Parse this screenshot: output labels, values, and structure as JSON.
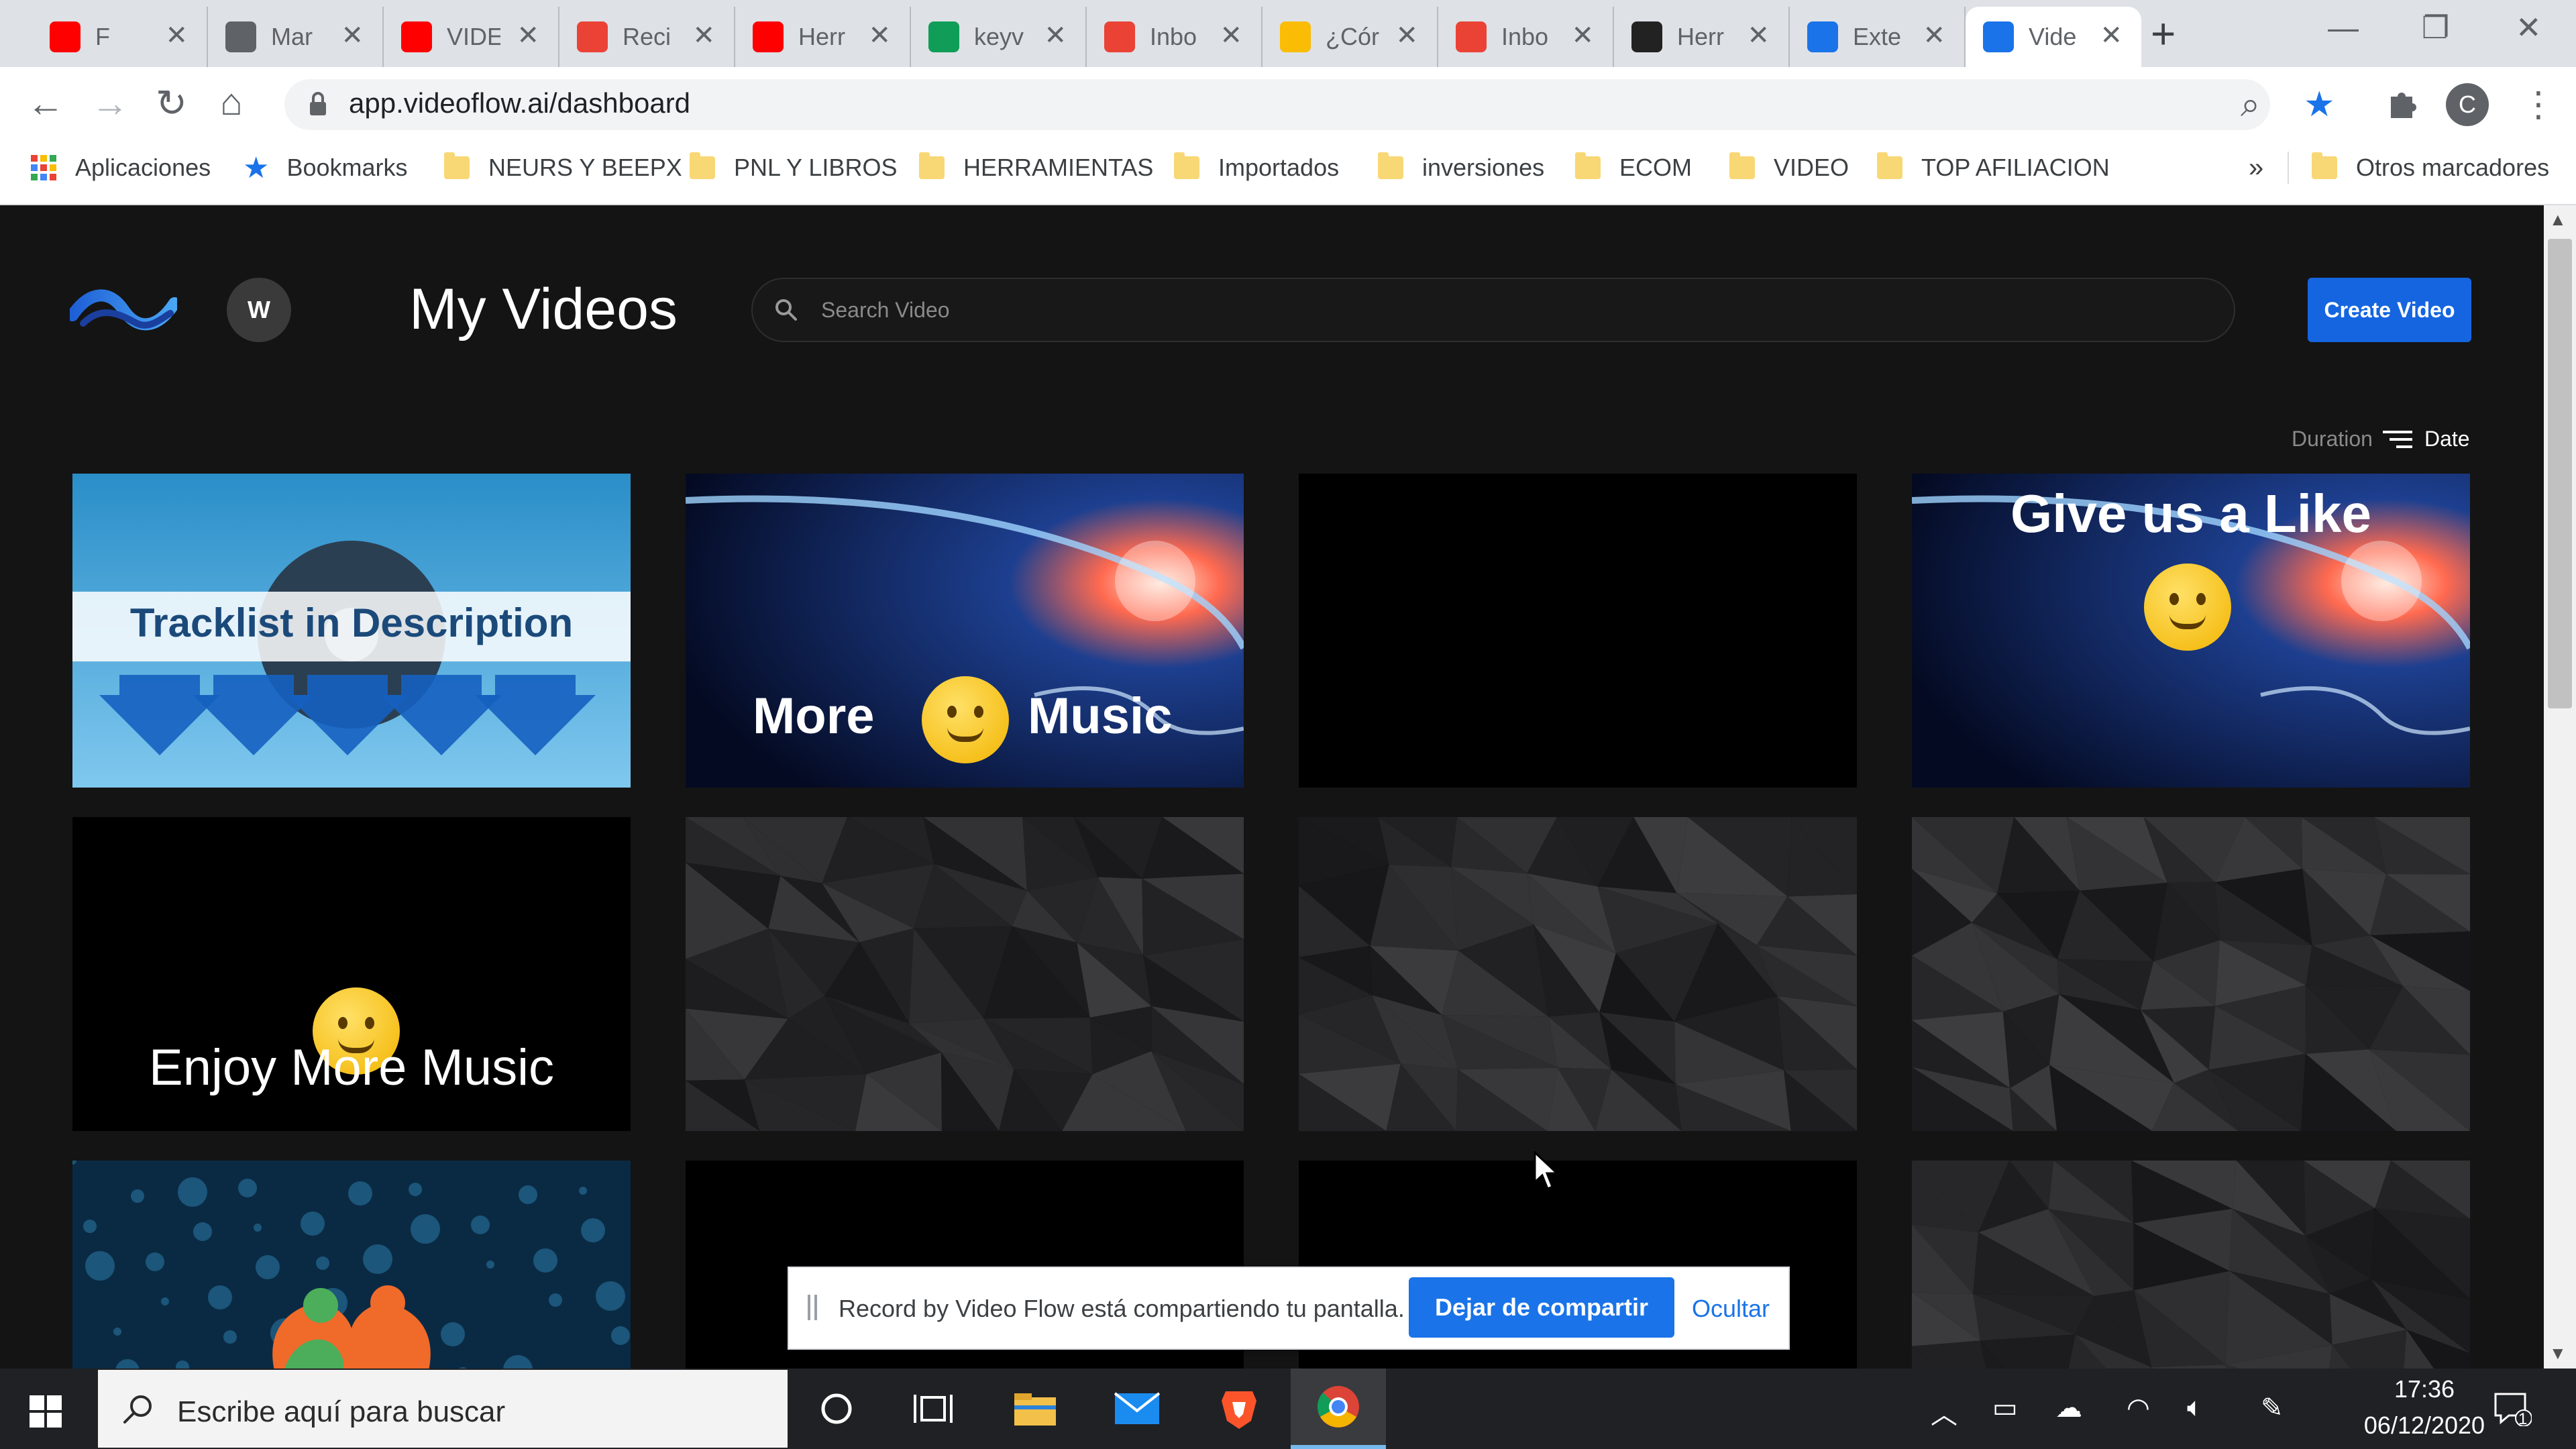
{
  "browser": {
    "tabs": [
      {
        "label": "F",
        "icon": "youtube-icon",
        "color": "#ff0000"
      },
      {
        "label": "Mar",
        "icon": "globe-icon",
        "color": "#5f6368"
      },
      {
        "label": "VIDE",
        "icon": "youtube-icon",
        "color": "#ff0000"
      },
      {
        "label": "Reci",
        "icon": "gmail-icon",
        "color": "#ea4335"
      },
      {
        "label": "Herr",
        "icon": "youtube-icon",
        "color": "#ff0000"
      },
      {
        "label": "keyv",
        "icon": "sheets-icon",
        "color": "#0f9d58"
      },
      {
        "label": "Inbo",
        "icon": "gmail-icon",
        "color": "#ea4335"
      },
      {
        "label": "¿Cór",
        "icon": "colorful-icon",
        "color": "#fbbc05"
      },
      {
        "label": "Inbo",
        "icon": "gmail-icon",
        "color": "#ea4335"
      },
      {
        "label": "Herr",
        "icon": "dark-app-icon",
        "color": "#222222"
      },
      {
        "label": "Exte",
        "icon": "puzzle-icon",
        "color": "#1a73e8"
      },
      {
        "label": "Vide",
        "icon": "videoflow-icon",
        "color": "#1a73e8",
        "active": true
      }
    ],
    "url": "app.videoflow.ai/dashboard",
    "bookmarks": [
      {
        "label": "Aplicaciones",
        "type": "apps"
      },
      {
        "label": "Bookmarks",
        "type": "star"
      },
      {
        "label": "NEURS Y BEEPX",
        "type": "folder"
      },
      {
        "label": "PNL Y LIBROS",
        "type": "folder"
      },
      {
        "label": "HERRAMIENTAS",
        "type": "folder"
      },
      {
        "label": "Importados",
        "type": "folder"
      },
      {
        "label": "inversiones",
        "type": "folder"
      },
      {
        "label": "ECOM",
        "type": "folder"
      },
      {
        "label": "VIDEO",
        "type": "folder"
      },
      {
        "label": "TOP AFILIACION",
        "type": "folder"
      }
    ],
    "more_bookmarks": "»",
    "other_bookmarks": "Otros marcadores",
    "profile_initial": "C"
  },
  "app": {
    "user_initial": "W",
    "title": "My Videos",
    "search_placeholder": "Search Video",
    "create_button": "Create Video",
    "sort": {
      "duration": "Duration",
      "date": "Date"
    },
    "videos": [
      {
        "id": "v1",
        "style": "tracklist",
        "text": "Tracklist in Description"
      },
      {
        "id": "v2",
        "style": "space",
        "text_left": "More",
        "text_right": "Music"
      },
      {
        "id": "v3",
        "style": "black"
      },
      {
        "id": "v4",
        "style": "space-like",
        "text": "Give us a Like"
      },
      {
        "id": "v5",
        "style": "enjoy",
        "text": "Enjoy More Music"
      },
      {
        "id": "v6",
        "style": "poly"
      },
      {
        "id": "v7",
        "style": "poly"
      },
      {
        "id": "v8",
        "style": "poly"
      },
      {
        "id": "v9",
        "style": "music-heart"
      },
      {
        "id": "v10",
        "style": "black"
      },
      {
        "id": "v11",
        "style": "black"
      },
      {
        "id": "v12",
        "style": "poly"
      }
    ]
  },
  "share_bar": {
    "message": "Record by Video Flow está compartiendo tu pantalla.",
    "stop_button": "Dejar de compartir",
    "hide_link": "Ocultar"
  },
  "taskbar": {
    "search_placeholder": "Escribe aquí para buscar",
    "time": "17:36",
    "date": "06/12/2020",
    "notifications": "1"
  },
  "colors": {
    "accent": "#1565e0",
    "background": "#141414"
  }
}
